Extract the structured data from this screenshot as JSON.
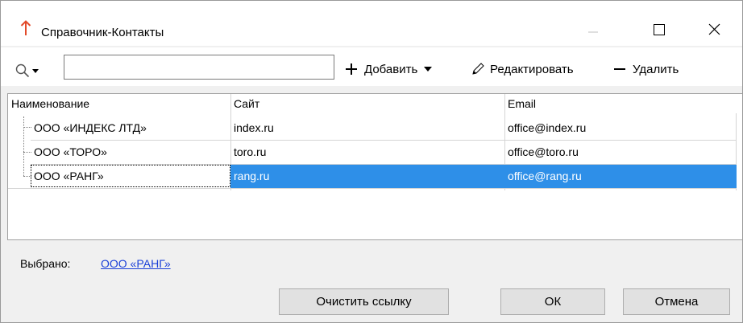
{
  "window": {
    "title": "Справочник-Контакты",
    "icon": "up-arrow-icon",
    "controls": [
      "minimize-icon",
      "maximize-icon",
      "close-icon"
    ]
  },
  "toolbar": {
    "search_value": "",
    "add_label": "Добавить",
    "edit_label": "Редактировать",
    "delete_label": "Удалить"
  },
  "grid": {
    "columns": [
      "Наименование",
      "Сайт",
      "Email"
    ],
    "rows": [
      {
        "name": "ООО «ИНДЕКС ЛТД»",
        "site": "index.ru",
        "email": "office@index.ru"
      },
      {
        "name": "ООО «ТОРО»",
        "site": "toro.ru",
        "email": "office@toro.ru"
      },
      {
        "name": "ООО «РАНГ»",
        "site": "rang.ru",
        "email": "office@rang.ru"
      }
    ],
    "selected_index": 2
  },
  "footer": {
    "selected_label": "Выбрано:",
    "selected_value": "ООО «РАНГ»",
    "clear_button": "Очистить ссылку",
    "ok_button": "ОК",
    "cancel_button": "Отмена"
  },
  "colors": {
    "selection": "#2e8fe8",
    "accent_icon": "#e24a2a",
    "link": "#1a3fd8"
  }
}
